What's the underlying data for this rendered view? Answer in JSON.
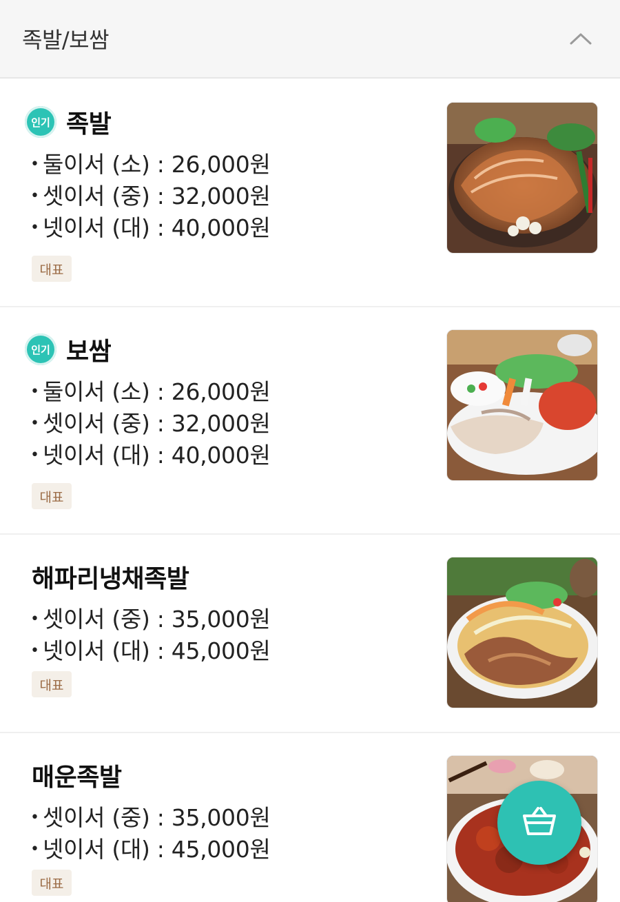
{
  "category": {
    "title": "족발/보쌈",
    "collapse_icon": "chevron-up-icon"
  },
  "colors": {
    "accent": "#2ec1b3",
    "tag_bg": "#f4efe8",
    "tag_text": "#9a6a44"
  },
  "items": [
    {
      "badge": "인기",
      "name": "족발",
      "prices": [
        "둘이서 (소) : 26,000원",
        "셋이서 (중) : 32,000원",
        "넷이서 (대) : 40,000원"
      ],
      "tag": "대표",
      "image": "jokbal-photo"
    },
    {
      "badge": "인기",
      "name": "보쌈",
      "prices": [
        "둘이서 (소) : 26,000원",
        "셋이서 (중) : 32,000원",
        "넷이서 (대) : 40,000원"
      ],
      "tag": "대표",
      "image": "bossam-photo"
    },
    {
      "name": "해파리냉채족발",
      "prices": [
        "셋이서 (중) : 35,000원",
        "넷이서 (대) : 45,000원"
      ],
      "tag": "대표",
      "image": "jellyfish-jokbal-photo"
    },
    {
      "name": "매운족발",
      "prices": [
        "셋이서 (중) : 35,000원",
        "넷이서 (대) : 45,000원"
      ],
      "tag": "대표",
      "image": "spicy-jokbal-photo"
    }
  ],
  "cart_button": {
    "icon": "shopping-basket-icon"
  }
}
